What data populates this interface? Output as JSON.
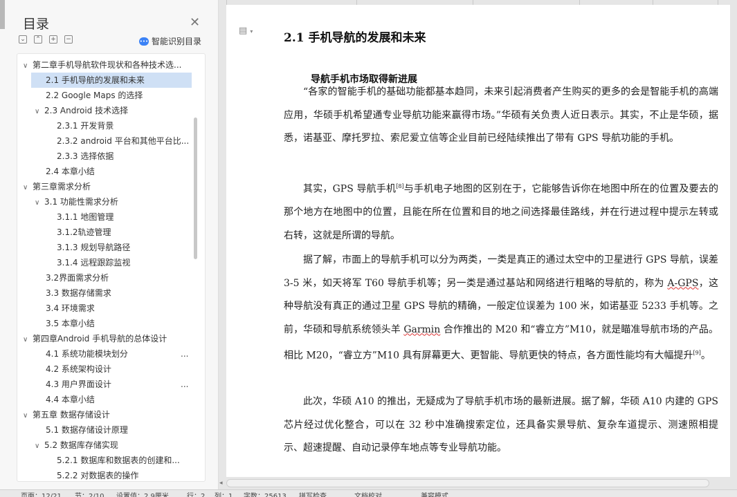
{
  "nav": {
    "title": "目录",
    "smart_toc_label": "智能识别目录",
    "items": [
      {
        "label": "第二章手机导航软件现状和各种技术选...",
        "caret": "∨",
        "active": false
      },
      {
        "label": "2.1 手机导航的发展和未来",
        "caret": "",
        "active": true
      },
      {
        "label": "2.2 Google Maps 的选择",
        "caret": "",
        "active": false
      },
      {
        "label": "2.3 Android  技术选择",
        "caret": "∨",
        "active": false
      },
      {
        "label": "2.3.1 开发背景",
        "caret": "",
        "active": false
      },
      {
        "label": "2.3.2 android 平台和其他平台比...",
        "caret": "",
        "active": false
      },
      {
        "label": "2.3.3  选择依据",
        "caret": "",
        "active": false
      },
      {
        "label": "2.4  本章小结",
        "caret": "",
        "active": false
      },
      {
        "label": "第三章需求分析",
        "caret": "∨",
        "active": false
      },
      {
        "label": "3.1  功能性需求分析",
        "caret": "∨",
        "active": false
      },
      {
        "label": "3.1.1  地图管理",
        "caret": "",
        "active": false
      },
      {
        "label": "3.1.2轨迹管理",
        "caret": "",
        "active": false
      },
      {
        "label": "3.1.3 规划导航路径",
        "caret": "",
        "active": false
      },
      {
        "label": "3.1.4 远程跟踪监视",
        "caret": "",
        "active": false
      },
      {
        "label": "3.2界面需求分析",
        "caret": "",
        "active": false
      },
      {
        "label": "3.3 数据存储需求",
        "caret": "",
        "active": false
      },
      {
        "label": "3.4  环境需求",
        "caret": "",
        "active": false
      },
      {
        "label": "3.5 本章小结",
        "caret": "",
        "active": false
      },
      {
        "label": "第四章Android 手机导航的总体设计",
        "caret": "∨",
        "active": false
      },
      {
        "label": "4.1  系统功能模块划分",
        "caret": "",
        "active": false
      },
      {
        "label": "4.2  系统架构设计",
        "caret": "",
        "active": false
      },
      {
        "label": "4.3 用户界面设计",
        "caret": "",
        "active": false
      },
      {
        "label": "4.4  本章小结",
        "caret": "",
        "active": false
      },
      {
        "label": "第五章  数据存储设计",
        "caret": "∨",
        "active": false
      },
      {
        "label": "5.1 数据存储设计原理",
        "caret": "",
        "active": false
      },
      {
        "label": "5.2 数据库存储实现",
        "caret": "∨",
        "active": false
      },
      {
        "label": "5.2.1  数据库和数据表的创建和...",
        "caret": "",
        "active": false
      },
      {
        "label": "5.2.2  对数据表的操作",
        "caret": "",
        "active": false
      }
    ],
    "more_label": "..."
  },
  "doc": {
    "heading": "2.1 手机导航的发展和未来",
    "subheading": "导航手机市场取得新进展",
    "p1": "“各家的智能手机的基础功能都基本趋同，未来引起消费者产生购买的更多的会是智能手机的高端应用，华硕手机希望通专业导航功能来赢得市场。”华硕有关负责人近日表示。其实，不止是华硕，据悉，诺基亚、摩托罗拉、索尼爱立信等企业目前已经陆续推出了带有 GPS 导航功能的手机。",
    "p2a": "其实，GPS 导航手机",
    "p2_ref": "[8]",
    "p2b": "与手机电子地图的区别在于，它能够告诉你在地图中所在的位置及要去的那个地方在地图中的位置，且能在所在位置和目的地之间选择最佳路线，并在行进过程中提示左转或右转，这就是所谓的导航。",
    "p3a": "据了解，市面上的导航手机可以分为两类，一类是真正的通过太空中的卫星进行 GPS 导航，误差 3-5 米，如天将军 T60 导航手机等；另一类是通过基站和网络进行粗略的导航的，称为 ",
    "p3_agps": "A-GPS",
    "p3b": "，这种导航没有真正的通过卫星 GPS 导航的精确，一般定位误差为 100 米，如诺基亚 5233 手机等。之前，华硕和导航系统领头羊 ",
    "p3_garmin": "Garmin",
    "p3c": " 合作推出的 M20 和“睿立方”M10，就是瞄准导航市场的产品。相比 M20，“睿立方”M10 具有屏幕更大、更智能、导航更快的特点，各方面性能均有大幅提升",
    "p3_ref": "[9]",
    "p3d": "。",
    "p4": "此次，华硕 A10 的推出，无疑成为了导航手机市场的最新进展。据了解，华硕 A10 内建的 GPS 芯片经过优化整合，可以在 32 秒中准确搜索定位，还具备实景导航、复杂车道提示、测速照相提示、超速提醒、自动记录停车地点等专业导航功能。"
  },
  "status": {
    "page": "页面：12/21",
    "section": "节：2/10",
    "setting": "设置值：2.9厘米",
    "row": "行：2",
    "col": "列：1",
    "words": "字数：25613",
    "spell": "拼写检查",
    "doc_check": "文档校对",
    "mode": "兼容模式"
  }
}
